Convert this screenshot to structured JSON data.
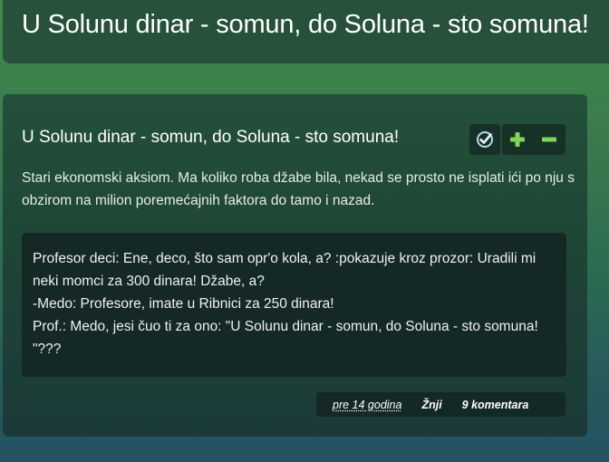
{
  "header": {
    "title": "U Solunu dinar - somun, do Soluna - sto somuna!"
  },
  "card": {
    "title": "U Solunu dinar - somun, do Soluna - sto somuna!",
    "description": "Stari ekonomski aksiom. Ma koliko roba džabe bila, nekad se prosto ne isplati ići po nju s obzirom na milion poremećajnih faktora do tamo i nazad.",
    "actions": [
      {
        "name": "check-icon",
        "label": ""
      },
      {
        "name": "plus-icon",
        "label": ""
      },
      {
        "name": "minus-icon",
        "label": ""
      }
    ],
    "quote_lines": [
      "Profesor deci: Ene, deco, što sam opr'o kola, a? :pokazuje kroz prozor: Uradili mi neki momci za 300 dinara! Džabe, a?",
      "-Medo: Profesore, imate u Ribnici za 250 dinara!",
      "Prof.: Medo, jesi čuo ti za ono: \"U Solunu dinar - somun, do Soluna - sto somuna! \"???"
    ],
    "meta": {
      "time": "pre 14 godina",
      "author": "Žnji",
      "comments": "9 komentara"
    }
  },
  "colors": {
    "accent_green": "#7dd65a",
    "check_blue": "#b9d6f0"
  }
}
